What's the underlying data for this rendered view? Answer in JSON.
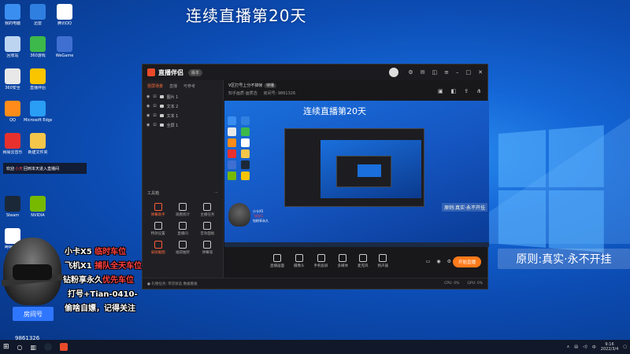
{
  "title_overlay": "连续直播第20天",
  "desktop_icons": [
    {
      "label": "我的电脑",
      "color": "#3a8ef0"
    },
    {
      "label": "360安全",
      "color": "#e8e8e8"
    },
    {
      "label": "迅雷",
      "color": "#2f7fe0"
    },
    {
      "label": "回收站",
      "color": "#bcd4f0"
    },
    {
      "label": "QQ",
      "color": "#ff8c1a"
    },
    {
      "label": "360游戏",
      "color": "#3cb94a"
    },
    {
      "label": "腾讯QQ",
      "color": "#ffffff"
    },
    {
      "label": "Microsoft Edge",
      "color": "#2a9df4"
    },
    {
      "label": "网易云音乐",
      "color": "#e8302f"
    },
    {
      "label": "新建文件夹",
      "color": "#f5c64a"
    },
    {
      "label": "WeGame",
      "color": "#3f6fd1"
    },
    {
      "label": "Steam",
      "color": "#1b2838"
    },
    {
      "label": "NVIDIA",
      "color": "#76b900"
    },
    {
      "label": "直播伴侣",
      "color": "#f9c400"
    },
    {
      "label": "哔哩哔哩",
      "color": "#ffffff"
    }
  ],
  "app": {
    "name": "直播伴侣",
    "version_tag": "版本",
    "left_tabs": [
      "竖屏场景",
      "直播",
      "可参考"
    ],
    "sources": [
      "图片 1",
      "文本 2",
      "文本 1",
      "全屏 1"
    ],
    "tools_header": "工具箱",
    "tools": [
      {
        "label": "弹幕助手",
        "red": true
      },
      {
        "label": "观看统计",
        "red": false
      },
      {
        "label": "主播任务",
        "red": false
      },
      {
        "label": "特效设置",
        "red": false
      },
      {
        "label": "直播间",
        "red": false
      },
      {
        "label": "音效面板",
        "red": false
      },
      {
        "label": "录屏截图",
        "red": true
      },
      {
        "label": "福袋抽奖",
        "red": false
      },
      {
        "label": "弹幕墙",
        "red": false
      }
    ],
    "room_title": "V区打号上分不掉帧",
    "room_status": "待播",
    "room_sub": [
      "知乎画质·画质选",
      "房间号: 9861326"
    ],
    "preview_title": "连续直播第20天",
    "preview_banner": "原则:真实·永不开挂",
    "preview_lines": [
      "小卡X5",
      "飞机X1",
      "钻粉享永久"
    ],
    "bottom_tools": [
      "直播画面",
      "摄像头",
      "手机投屏",
      "多媒体",
      "麦克风",
      "扬声器"
    ],
    "start_live": "开始直播",
    "status_left": "● 礼物任务: 带货状态  数据看板",
    "status_right": [
      "CPU: 0%",
      "GPU: 0%"
    ]
  },
  "popup": {
    "prefix": "欢迎",
    "highlight": "小天",
    "suffix": "回到本天进入直播间"
  },
  "right_banner": "原则:真实·永不开挂",
  "overlay": {
    "line1_a": "小卡X5",
    "line1_b": "临时车位",
    "line2_a": "飞机X1",
    "line2_b": "捕队全天车位",
    "line3_a": "钻粉享永久",
    "line3_b": "优先车位",
    "line4": "打号+Tian-0410-",
    "line5": "偷啥自嫖，记得关注"
  },
  "streamer": {
    "label": "房间号",
    "room_number": "9861326"
  },
  "taskbar": {
    "time": "9:16",
    "date": "2022/3/4"
  }
}
